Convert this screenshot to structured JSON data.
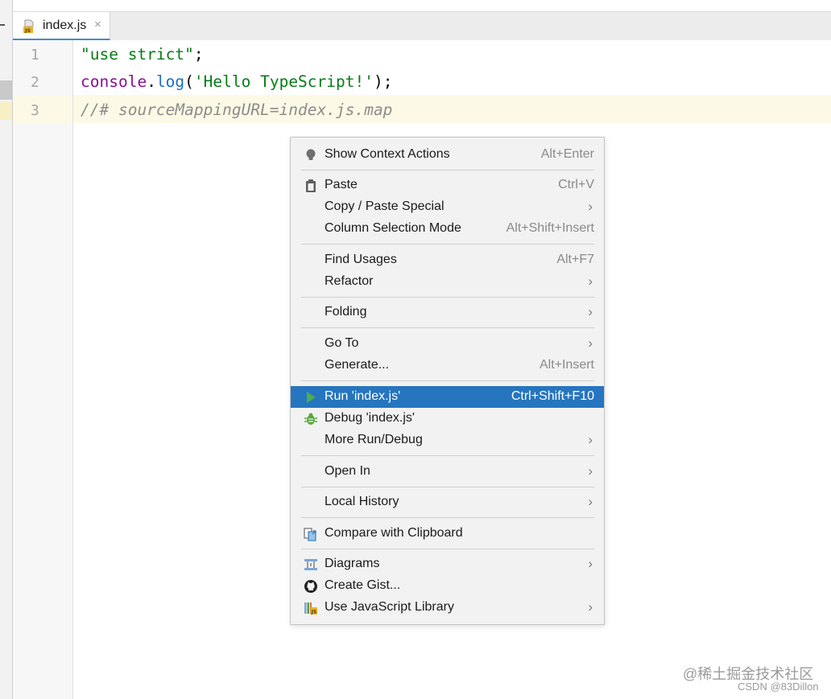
{
  "tab": {
    "filename": "index.js",
    "close": "×",
    "icon": "js-file-icon"
  },
  "gutter": {
    "lines": [
      "1",
      "2",
      "3"
    ]
  },
  "code": {
    "line1": {
      "string": "\"use strict\"",
      "semi": ";"
    },
    "line2": {
      "obj": "console",
      "dot": ".",
      "fn": "log",
      "open": "(",
      "arg": "'Hello TypeScript!'",
      "close": ");"
    },
    "line3": {
      "comment": "//# sourceMappingURL=index.js.map"
    }
  },
  "menu": {
    "show_context_actions": {
      "label": "Show Context Actions",
      "shortcut": "Alt+Enter",
      "icon": "lightbulb-icon"
    },
    "paste": {
      "label": "Paste",
      "shortcut": "Ctrl+V",
      "icon": "clipboard-icon"
    },
    "copy_paste_special": {
      "label": "Copy / Paste Special"
    },
    "column_selection_mode": {
      "label": "Column Selection Mode",
      "shortcut": "Alt+Shift+Insert"
    },
    "find_usages": {
      "label": "Find Usages",
      "shortcut": "Alt+F7"
    },
    "refactor": {
      "label": "Refactor"
    },
    "folding": {
      "label": "Folding"
    },
    "go_to": {
      "label": "Go To"
    },
    "generate": {
      "label": "Generate...",
      "shortcut": "Alt+Insert"
    },
    "run": {
      "label": "Run 'index.js'",
      "shortcut": "Ctrl+Shift+F10",
      "icon": "run-icon"
    },
    "debug": {
      "label": "Debug 'index.js'",
      "icon": "debug-bug-icon"
    },
    "more_run_debug": {
      "label": "More Run/Debug"
    },
    "open_in": {
      "label": "Open In"
    },
    "local_history": {
      "label": "Local History"
    },
    "compare_clipboard": {
      "label": "Compare with Clipboard",
      "icon": "compare-icon"
    },
    "diagrams": {
      "label": "Diagrams",
      "icon": "diagram-icon"
    },
    "create_gist": {
      "label": "Create Gist...",
      "icon": "github-icon"
    },
    "use_js_library": {
      "label": "Use JavaScript Library",
      "icon": "js-library-icon"
    },
    "submenu_arrow": "›"
  },
  "colors": {
    "selection": "#2675bf",
    "menu_bg": "#f2f2f2",
    "current_line": "#fcfae6"
  },
  "watermark": {
    "line1": "@稀土掘金技术社区",
    "line2": "CSDN @83Dillon"
  }
}
